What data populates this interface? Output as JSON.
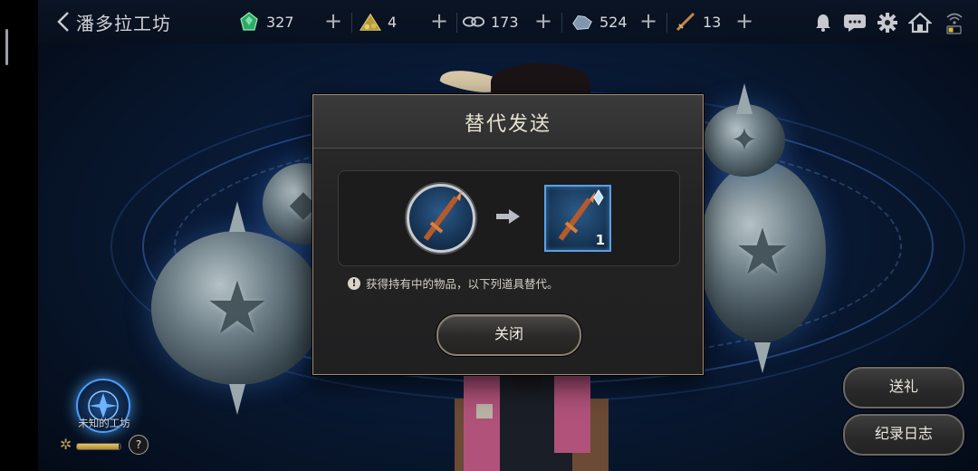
{
  "header": {
    "title": "潘多拉工坊",
    "resources": [
      {
        "icon": "green-gem-icon",
        "value": "327"
      },
      {
        "icon": "gold-pile-icon",
        "value": "4"
      },
      {
        "icon": "infinity-chain-icon",
        "value": "173"
      },
      {
        "icon": "ore-chunk-icon",
        "value": "524"
      },
      {
        "icon": "dagger-icon",
        "value": "13"
      }
    ]
  },
  "modal": {
    "title": "替代发送",
    "item_count": "1",
    "notice": "获得持有中的物品，以下列道具替代。",
    "close_label": "关闭"
  },
  "workshop": {
    "label": "未知的工坊",
    "progress": 0.95,
    "help": "?"
  },
  "buttons": {
    "gift": "送礼",
    "log": "纪录日志"
  },
  "colors": {
    "modal_border": "#9a8d73",
    "item_frame": "#5aa0e6",
    "progress_fill": "#e6c46a"
  }
}
